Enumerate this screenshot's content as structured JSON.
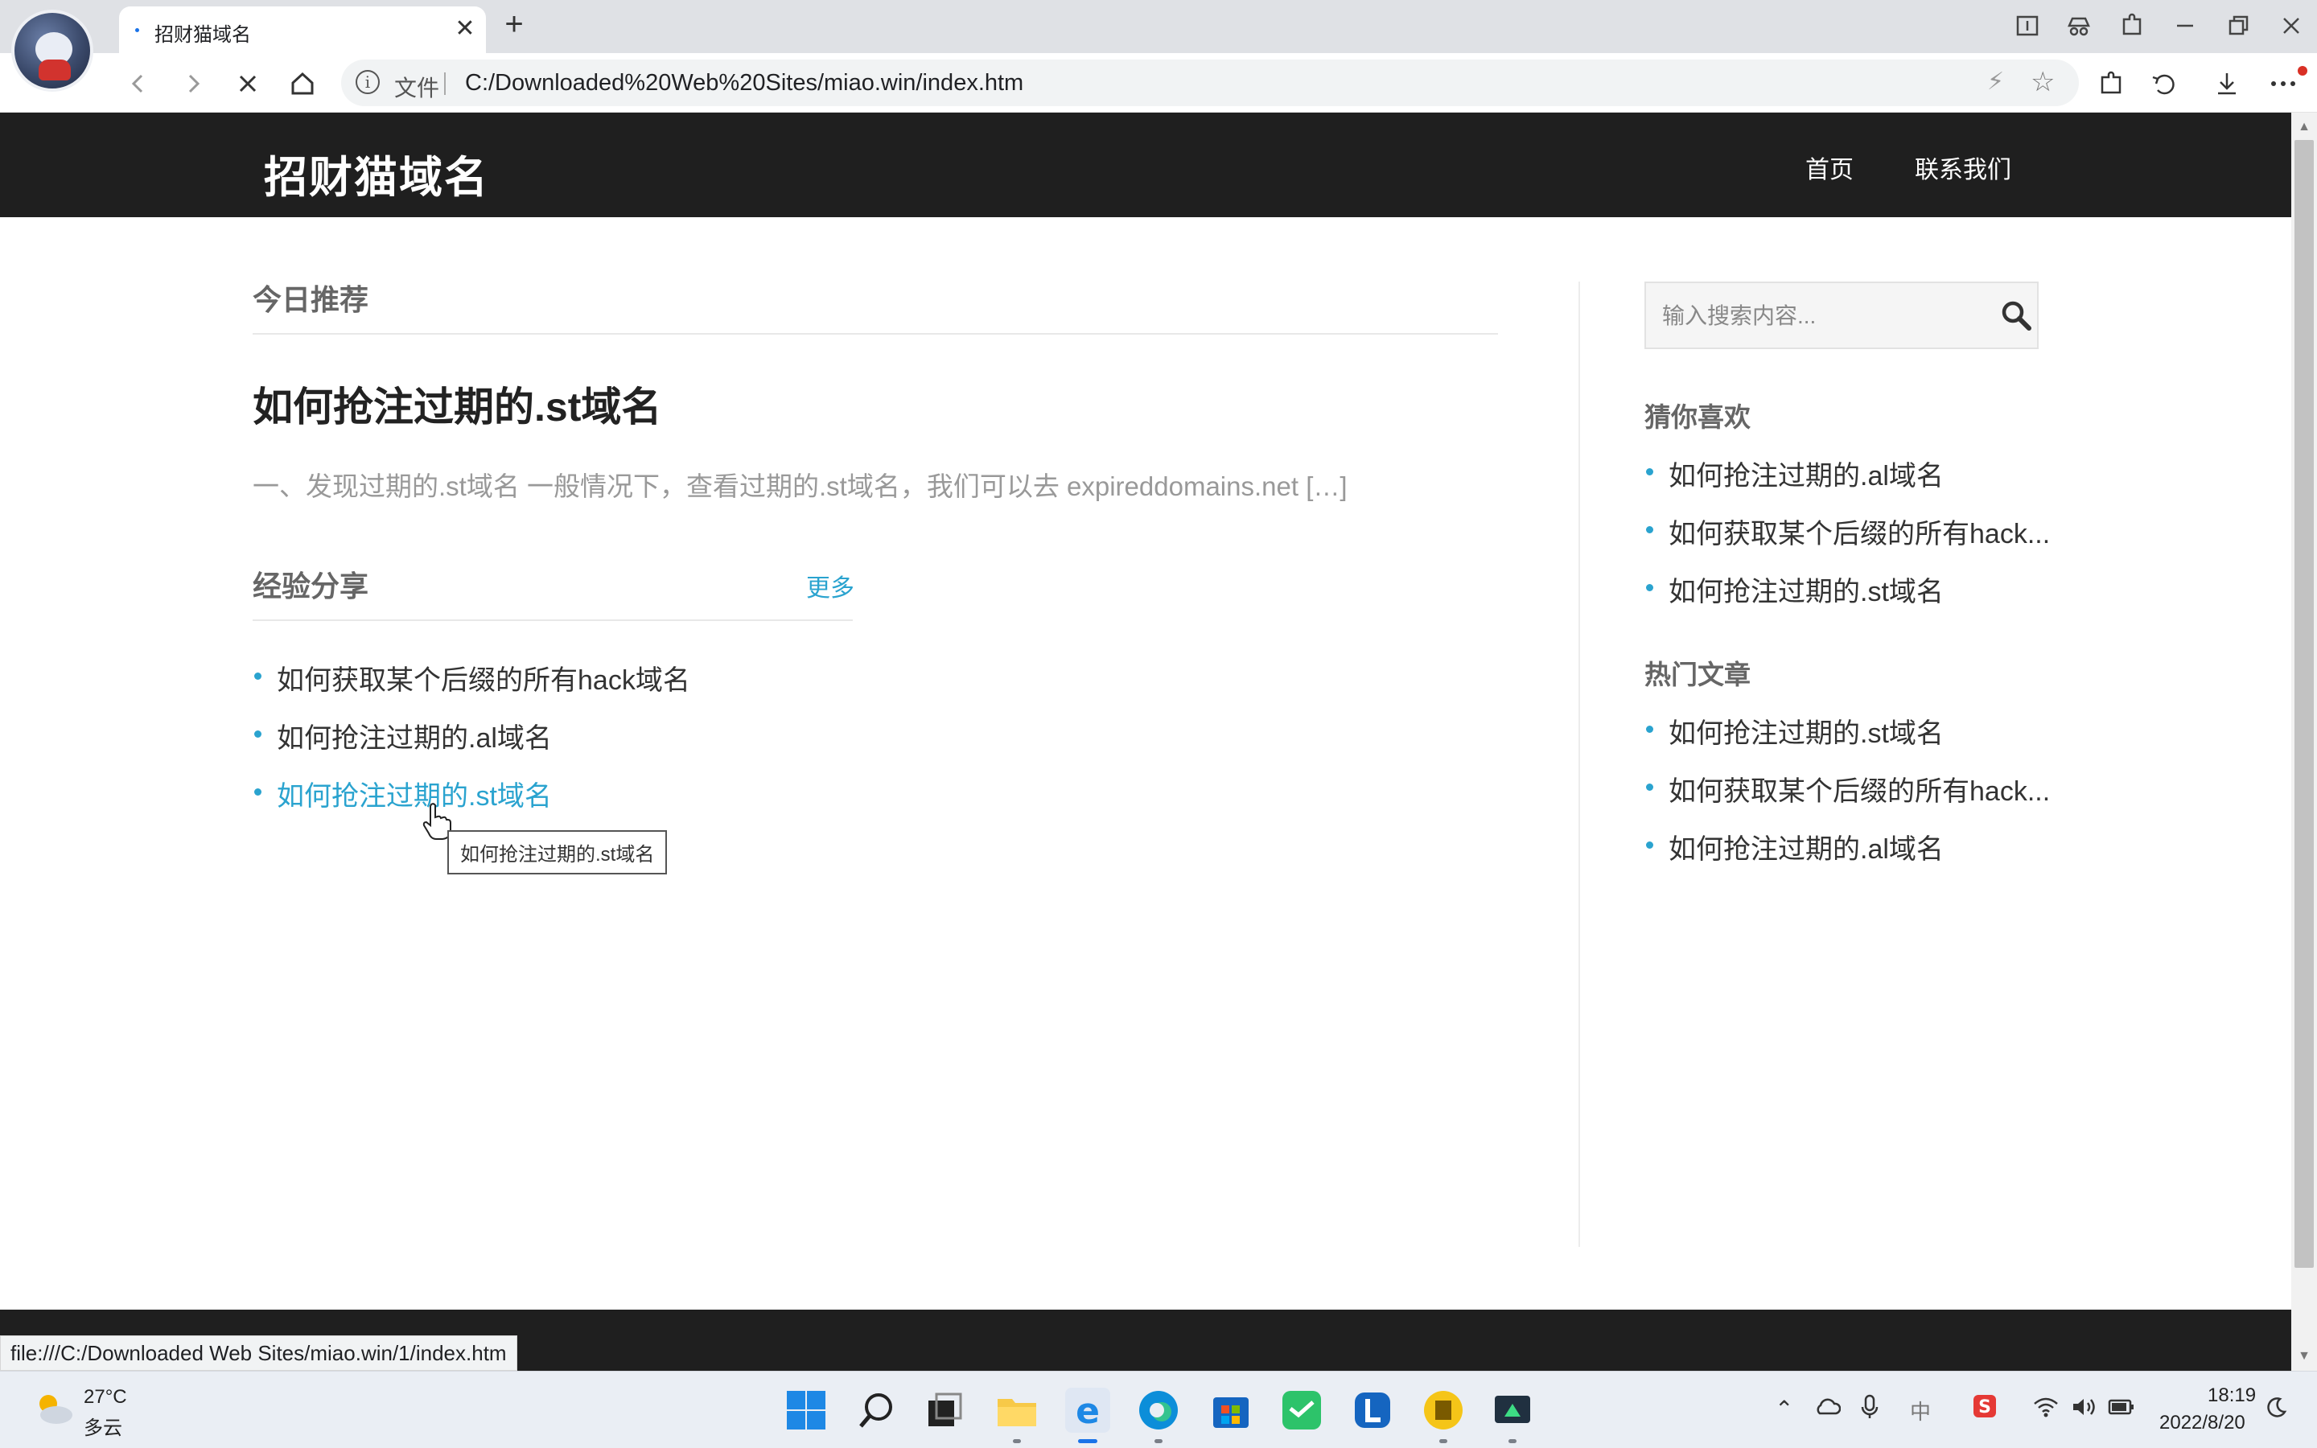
{
  "browser": {
    "tab_title": "招财猫域名",
    "tab_close": "✕",
    "new_tab": "+",
    "protocol_label": "文件",
    "url": "C:/Downloaded%20Web%20Sites/miao.win/index.htm",
    "status_url": "file:///C:/Downloaded Web Sites/miao.win/1/index.htm"
  },
  "site": {
    "logo": "招财猫域名",
    "nav": [
      "首页",
      "联系我们"
    ]
  },
  "main": {
    "featured_heading": "今日推荐",
    "featured_post": {
      "title": "如何抢注过期的.st域名",
      "excerpt": "一、发现过期的.st域名 一般情况下，查看过期的.st域名，我们可以去 expireddomains.net […]"
    },
    "experience": {
      "heading": "经验分享",
      "more_label": "更多",
      "items": [
        "如何获取某个后缀的所有hack域名",
        "如何抢注过期的.al域名",
        "如何抢注过期的.st域名"
      ],
      "hovered_index": 2
    },
    "tooltip": "如何抢注过期的.st域名"
  },
  "sidebar": {
    "search_placeholder": "输入搜索内容...",
    "guess": {
      "heading": "猜你喜欢",
      "items": [
        "如何抢注过期的.al域名",
        "如何获取某个后缀的所有hack...",
        "如何抢注过期的.st域名"
      ]
    },
    "hot": {
      "heading": "热门文章",
      "items": [
        "如何抢注过期的.st域名",
        "如何获取某个后缀的所有hack...",
        "如何抢注过期的.al域名"
      ]
    }
  },
  "taskbar": {
    "weather_temp": "27°C",
    "weather_desc": "多云",
    "ime_label": "中",
    "time": "18:19",
    "date": "2022/8/20"
  },
  "colors": {
    "header_bg": "#1f1f1f",
    "accent": "#2aa3cf",
    "link_hover": "#2aa3cf"
  },
  "icons": [
    "avatar",
    "back-icon",
    "forward-icon",
    "stop-icon",
    "home-icon",
    "info-icon",
    "bolt-icon",
    "star-icon",
    "extensions-icon",
    "history-icon",
    "download-icon",
    "menu-icon",
    "search-icon",
    "windows-start-icon",
    "taskbar-search-icon",
    "task-view-icon",
    "file-explorer-icon",
    "ie-icon",
    "edge-icon",
    "store-icon",
    "wechat-icon",
    "lenovo-icon",
    "notes-icon",
    "app-icon",
    "weather-icon",
    "wifi-icon",
    "volume-icon",
    "battery-icon",
    "moon-icon"
  ]
}
